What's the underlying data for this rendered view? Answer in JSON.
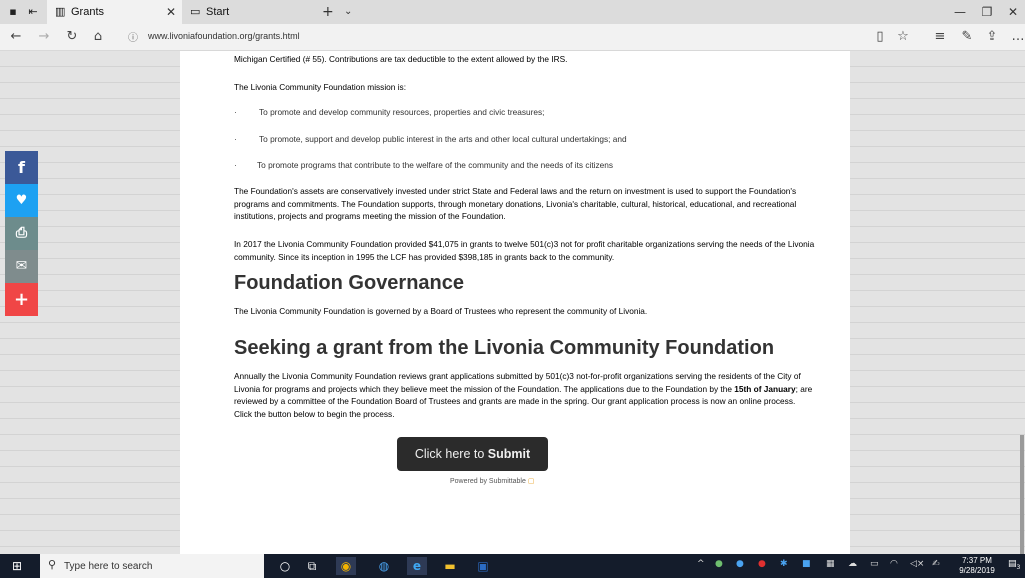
{
  "browser": {
    "active_tab_title": "Grants",
    "inactive_tab_title": "Start",
    "url": "www.livoniafoundation.org/grants.html"
  },
  "page": {
    "intro_line": "Michigan Certified (# 55). Contributions are tax deductible to the extent allowed by the IRS.",
    "mission_heading": "The Livonia Community Foundation mission is:",
    "bullets": [
      "To promote and develop community resources, properties and civic treasures;",
      "To promote, support and develop public interest in the arts and other local cultural undertakings; and",
      "To promote programs that contribute to the welfare of the community and the needs of its citizens"
    ],
    "bullet_char": "·",
    "assets_text": "The Foundation's assets are conservatively invested under strict State and Federal laws and the return on investment is used to support the Foundation's programs and commitments.  The Foundation supports, through monetary donations, Livonia's charitable, cultural, historical, educational, and recreational institutions, projects and programs meeting the mission of the Foundation.",
    "grants_text": "In 2017 the Livonia Community Foundation provided $41,075 in grants to twelve 501(c)3 not for profit charitable organizations serving the needs of the Livonia community.  Since its inception in 1995 the LCF has provided $398,185 in grants back to the community.",
    "governance_heading": "Foundation Governance",
    "governance_text": "The Livonia Community Foundation is governed by a Board of Trustees who represent the community of Livonia.",
    "seeking_heading": "Seeking a grant from the Livonia Community Foundation",
    "seeking_text_1": "Annually the Livonia Community Foundation reviews grant applications submitted by 501(c)3 not-for-profit organizations serving the residents of the City of Livonia for programs and projects which they believe meet the mission of the Foundation.  The applications due to the Foundation by the ",
    "seeking_bold": "15th of January",
    "seeking_text_2": "; are reviewed by a committee of the Foundation Board of Trustees and grants are made in the spring.  Our grant application process is now an online process.  Click the button below to begin the process.",
    "submit_prefix": "Click here to ",
    "submit_bold": "Submit",
    "powered_by": "Powered by Submittable"
  },
  "social": [
    {
      "icon": "facebook-icon",
      "glyph": "f",
      "color": "#3b5998"
    },
    {
      "icon": "twitter-icon",
      "glyph": "🐦",
      "color": "#1da1f2"
    },
    {
      "icon": "print-icon",
      "glyph": "⎙",
      "color": "#6d8c8c"
    },
    {
      "icon": "email-icon",
      "glyph": "✉",
      "color": "#7f8c8d"
    },
    {
      "icon": "share-plus-icon",
      "glyph": "+",
      "color": "#f04646"
    }
  ],
  "taskbar": {
    "search_placeholder": "Type here to search",
    "time": "7:37 PM",
    "date": "9/28/2019",
    "notification_count": "3"
  }
}
